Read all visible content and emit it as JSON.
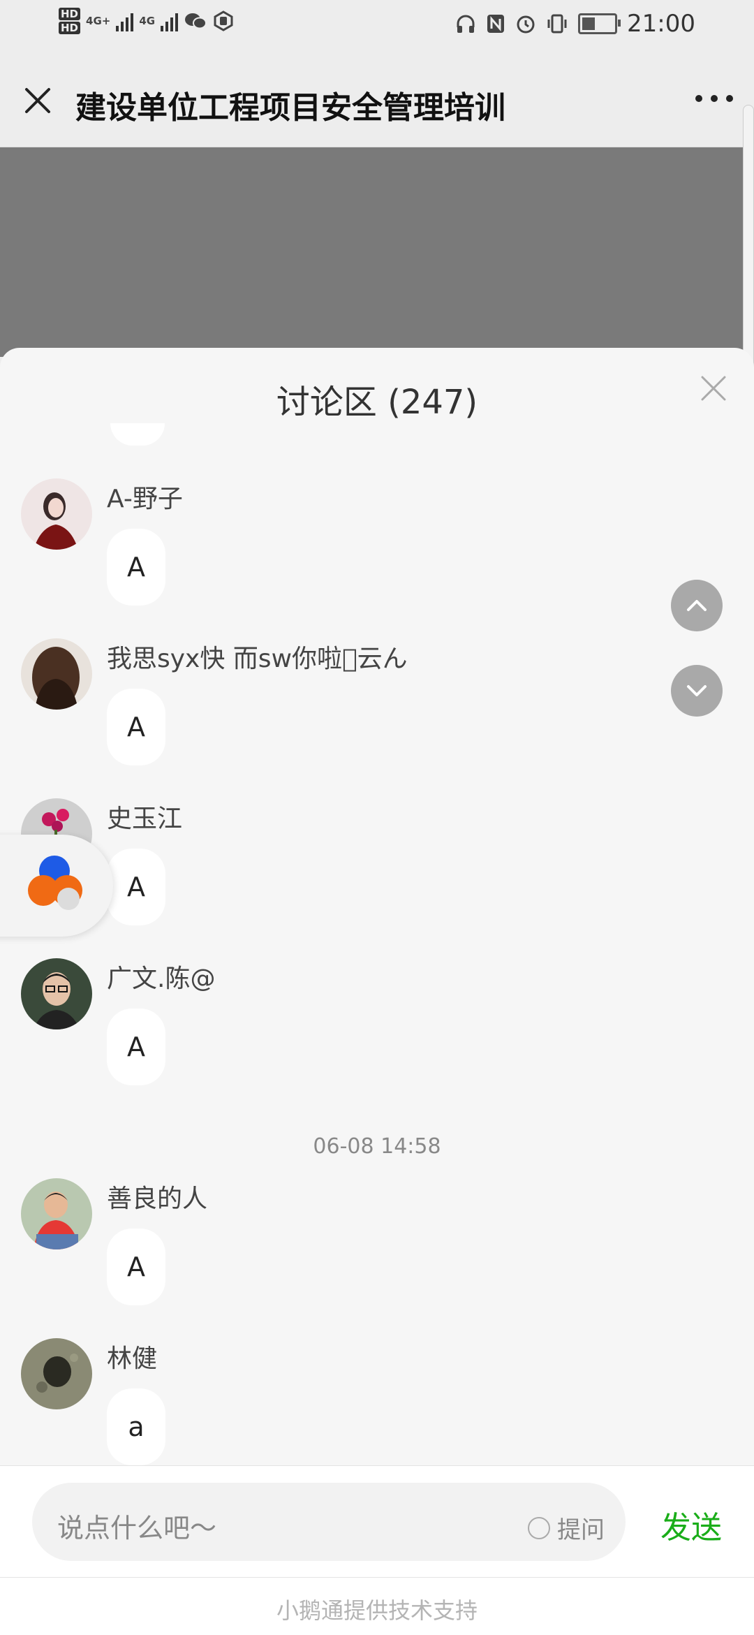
{
  "status_bar": {
    "time": "21:00",
    "network_1": "4G+",
    "network_2": "4G",
    "hd_1": "HD",
    "hd_2": "HD"
  },
  "header": {
    "title": "建设单位工程项目安全管理培训"
  },
  "discussion": {
    "title": "讨论区 (247)",
    "messages": [
      {
        "name": "A-野子",
        "text": "A"
      },
      {
        "name": "我思syx快 而sw你啦\u0000云ん",
        "text": "A"
      },
      {
        "name": "史玉江",
        "text": "A"
      },
      {
        "name": "广文.陈@",
        "text": "A"
      },
      {
        "name": "善良的人",
        "text": "A"
      },
      {
        "name": "林健",
        "text": "a"
      }
    ],
    "timestamp": "06-08 14:58"
  },
  "input": {
    "placeholder": "说点什么吧～",
    "ask_label": "提问",
    "send_label": "发送"
  },
  "footer": {
    "text": "小鹅通提供技术支持"
  },
  "colors": {
    "send": "#1aad19",
    "panel_bg": "#f6f6f6",
    "video_bg": "#7a7a7a"
  }
}
